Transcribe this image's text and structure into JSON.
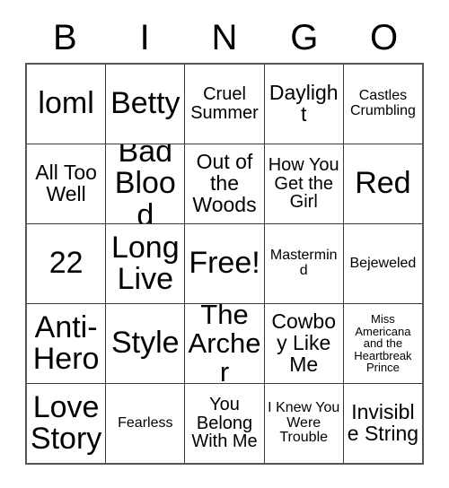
{
  "card": {
    "header": {
      "letters": [
        "B",
        "I",
        "N",
        "G",
        "O"
      ]
    },
    "rows": [
      [
        {
          "text": "loml",
          "size": "fs-xxl"
        },
        {
          "text": "Betty",
          "size": "fs-xxl"
        },
        {
          "text": "Cruel Summer",
          "size": "fs-m"
        },
        {
          "text": "Daylight",
          "size": "fs-l"
        },
        {
          "text": "Castles Crumbling",
          "size": "fs-s"
        }
      ],
      [
        {
          "text": "All Too Well",
          "size": "fs-l"
        },
        {
          "text": "Bad Blood",
          "size": "fs-xxl"
        },
        {
          "text": "Out of the Woods",
          "size": "fs-l"
        },
        {
          "text": "How You Get the Girl",
          "size": "fs-m"
        },
        {
          "text": "Red",
          "size": "fs-xxl"
        }
      ],
      [
        {
          "text": "22",
          "size": "fs-xxl"
        },
        {
          "text": "Long Live",
          "size": "fs-xxl"
        },
        {
          "text": "Free!",
          "size": "fs-xxl"
        },
        {
          "text": "Mastermind",
          "size": "fs-s"
        },
        {
          "text": "Bejeweled",
          "size": "fs-s"
        }
      ],
      [
        {
          "text": "Anti-Hero",
          "size": "fs-xxl"
        },
        {
          "text": "Style",
          "size": "fs-xxl"
        },
        {
          "text": "The Archer",
          "size": "fs-xl"
        },
        {
          "text": "Cowboy Like Me",
          "size": "fs-l"
        },
        {
          "text": "Miss Americana and the Heartbreak Prince",
          "size": "fs-xs"
        }
      ],
      [
        {
          "text": "Love Story",
          "size": "fs-xxl"
        },
        {
          "text": "Fearless",
          "size": "fs-s"
        },
        {
          "text": "You Belong With Me",
          "size": "fs-m"
        },
        {
          "text": "I Knew You Were Trouble",
          "size": "fs-s"
        },
        {
          "text": "Invisible String",
          "size": "fs-l"
        }
      ]
    ]
  },
  "colors": {
    "background": "#ffffff",
    "text": "#000000",
    "outer_border": "#555555",
    "inner_border": "#3a3a3a"
  }
}
